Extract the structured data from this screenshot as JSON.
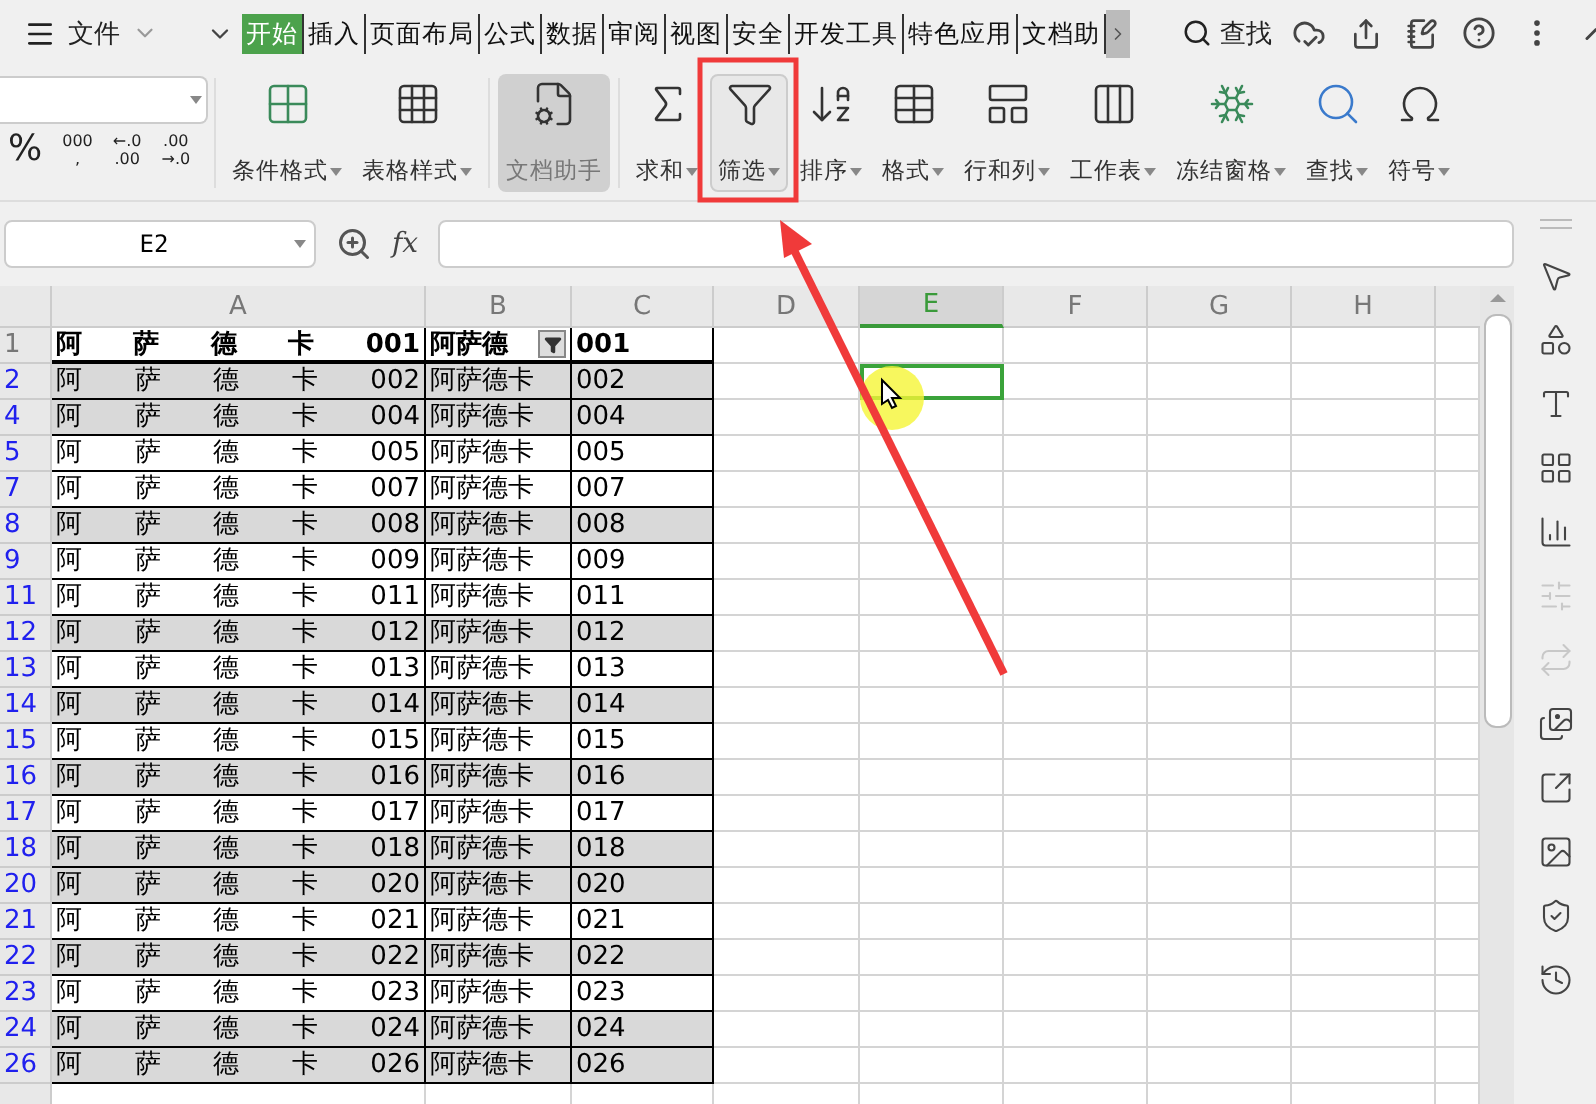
{
  "menu": {
    "file_label": "文件",
    "tabs": [
      {
        "label": "开始",
        "selected": true
      },
      {
        "label": "插入",
        "selected": false
      },
      {
        "label": "页面布局",
        "selected": false
      },
      {
        "label": "公式",
        "selected": false
      },
      {
        "label": "数据",
        "selected": false
      },
      {
        "label": "审阅",
        "selected": false
      },
      {
        "label": "视图",
        "selected": false
      },
      {
        "label": "安全",
        "selected": false
      },
      {
        "label": "开发工具",
        "selected": false
      },
      {
        "label": "特色应用",
        "selected": false
      },
      {
        "label": "文档助",
        "selected": false
      }
    ],
    "search_label": "查找"
  },
  "ribbon": {
    "number_formats": [
      {
        "lines": [
          "%"
        ]
      },
      {
        "lines": [
          "000",
          ","
        ]
      },
      {
        "lines": [
          "←.0",
          ".00"
        ]
      },
      {
        "lines": [
          ".00",
          "→.0"
        ]
      }
    ],
    "buttons": [
      {
        "kind": "conditional",
        "label": "条件格式",
        "dropdown": true,
        "pressed": false
      },
      {
        "kind": "table-style",
        "label": "表格样式",
        "dropdown": true,
        "pressed": false
      },
      {
        "kind": "assistant",
        "label": "文档助手",
        "dropdown": false,
        "pressed": true
      },
      {
        "kind": "sum",
        "label": "求和",
        "dropdown": true,
        "pressed": false
      },
      {
        "kind": "filter",
        "label": "筛选",
        "dropdown": true,
        "pressed": true
      },
      {
        "kind": "sort",
        "label": "排序",
        "dropdown": true,
        "pressed": false
      },
      {
        "kind": "format",
        "label": "格式",
        "dropdown": true,
        "pressed": false
      },
      {
        "kind": "rows-cols",
        "label": "行和列",
        "dropdown": true,
        "pressed": false
      },
      {
        "kind": "sheet",
        "label": "工作表",
        "dropdown": true,
        "pressed": false
      },
      {
        "kind": "freeze",
        "label": "冻结窗格",
        "dropdown": true,
        "pressed": false
      },
      {
        "kind": "find",
        "label": "查找",
        "dropdown": true,
        "pressed": false
      },
      {
        "kind": "symbol",
        "label": "符号",
        "dropdown": true,
        "pressed": false
      }
    ]
  },
  "formula_bar": {
    "name_box": "E2",
    "fx_label": "fx"
  },
  "sheet": {
    "columns": [
      {
        "label": "A",
        "selected": false
      },
      {
        "label": "B",
        "selected": false
      },
      {
        "label": "C",
        "selected": false
      },
      {
        "label": "D",
        "selected": false
      },
      {
        "label": "E",
        "selected": true
      },
      {
        "label": "F",
        "selected": false
      },
      {
        "label": "G",
        "selected": false
      },
      {
        "label": "H",
        "selected": false
      }
    ],
    "rows": [
      {
        "number": "1",
        "kind": "header",
        "filtered": false,
        "shaded": false,
        "selected": false,
        "cells": [
          "阿 萨 德 卡 001",
          "阿萨德",
          "001"
        ]
      },
      {
        "number": "2",
        "kind": "data",
        "filtered": true,
        "shaded": true,
        "selected": true,
        "cells": [
          "阿 萨 德 卡 002",
          "阿萨德卡",
          "002"
        ]
      },
      {
        "number": "4",
        "kind": "data",
        "filtered": true,
        "shaded": true,
        "selected": false,
        "cells": [
          "阿 萨 德 卡 004",
          "阿萨德卡",
          "004"
        ]
      },
      {
        "number": "5",
        "kind": "data",
        "filtered": true,
        "shaded": false,
        "selected": false,
        "cells": [
          "阿 萨 德 卡 005",
          "阿萨德卡",
          "005"
        ]
      },
      {
        "number": "7",
        "kind": "data",
        "filtered": true,
        "shaded": false,
        "selected": false,
        "cells": [
          "阿 萨 德 卡 007",
          "阿萨德卡",
          "007"
        ]
      },
      {
        "number": "8",
        "kind": "data",
        "filtered": true,
        "shaded": true,
        "selected": false,
        "cells": [
          "阿 萨 德 卡 008",
          "阿萨德卡",
          "008"
        ]
      },
      {
        "number": "9",
        "kind": "data",
        "filtered": true,
        "shaded": false,
        "selected": false,
        "cells": [
          "阿 萨 德 卡 009",
          "阿萨德卡",
          "009"
        ]
      },
      {
        "number": "11",
        "kind": "data",
        "filtered": true,
        "shaded": false,
        "selected": false,
        "cells": [
          "阿 萨 德 卡 011",
          "阿萨德卡",
          "011"
        ]
      },
      {
        "number": "12",
        "kind": "data",
        "filtered": true,
        "shaded": true,
        "selected": false,
        "cells": [
          "阿 萨 德 卡 012",
          "阿萨德卡",
          "012"
        ]
      },
      {
        "number": "13",
        "kind": "data",
        "filtered": true,
        "shaded": false,
        "selected": false,
        "cells": [
          "阿 萨 德 卡 013",
          "阿萨德卡",
          "013"
        ]
      },
      {
        "number": "14",
        "kind": "data",
        "filtered": true,
        "shaded": true,
        "selected": false,
        "cells": [
          "阿 萨 德 卡 014",
          "阿萨德卡",
          "014"
        ]
      },
      {
        "number": "15",
        "kind": "data",
        "filtered": true,
        "shaded": false,
        "selected": false,
        "cells": [
          "阿 萨 德 卡 015",
          "阿萨德卡",
          "015"
        ]
      },
      {
        "number": "16",
        "kind": "data",
        "filtered": true,
        "shaded": true,
        "selected": false,
        "cells": [
          "阿 萨 德 卡 016",
          "阿萨德卡",
          "016"
        ]
      },
      {
        "number": "17",
        "kind": "data",
        "filtered": true,
        "shaded": false,
        "selected": false,
        "cells": [
          "阿 萨 德 卡 017",
          "阿萨德卡",
          "017"
        ]
      },
      {
        "number": "18",
        "kind": "data",
        "filtered": true,
        "shaded": true,
        "selected": false,
        "cells": [
          "阿 萨 德 卡 018",
          "阿萨德卡",
          "018"
        ]
      },
      {
        "number": "20",
        "kind": "data",
        "filtered": true,
        "shaded": true,
        "selected": false,
        "cells": [
          "阿 萨 德 卡 020",
          "阿萨德卡",
          "020"
        ]
      },
      {
        "number": "21",
        "kind": "data",
        "filtered": true,
        "shaded": false,
        "selected": false,
        "cells": [
          "阿 萨 德 卡 021",
          "阿萨德卡",
          "021"
        ]
      },
      {
        "number": "22",
        "kind": "data",
        "filtered": true,
        "shaded": true,
        "selected": false,
        "cells": [
          "阿 萨 德 卡 022",
          "阿萨德卡",
          "022"
        ]
      },
      {
        "number": "23",
        "kind": "data",
        "filtered": true,
        "shaded": false,
        "selected": false,
        "cells": [
          "阿 萨 德 卡 023",
          "阿萨德卡",
          "023"
        ]
      },
      {
        "number": "24",
        "kind": "data",
        "filtered": true,
        "shaded": true,
        "selected": false,
        "cells": [
          "阿 萨 德 卡 024",
          "阿萨德卡",
          "024"
        ]
      },
      {
        "number": "26",
        "kind": "data",
        "filtered": true,
        "shaded": true,
        "selected": false,
        "cells": [
          "阿 萨 德 卡 026",
          "阿萨德卡",
          "026"
        ]
      }
    ]
  },
  "side_tools": [
    {
      "kind": "pointer",
      "disabled": false
    },
    {
      "kind": "shapes",
      "disabled": false
    },
    {
      "kind": "text-style",
      "disabled": false
    },
    {
      "kind": "grid",
      "disabled": false
    },
    {
      "kind": "chart",
      "disabled": false
    },
    {
      "kind": "sliders",
      "disabled": true
    },
    {
      "kind": "transform",
      "disabled": true
    },
    {
      "kind": "gallery",
      "disabled": false
    },
    {
      "kind": "share",
      "disabled": false
    },
    {
      "kind": "image",
      "disabled": false
    },
    {
      "kind": "shield",
      "disabled": false
    },
    {
      "kind": "history",
      "disabled": false
    }
  ]
}
